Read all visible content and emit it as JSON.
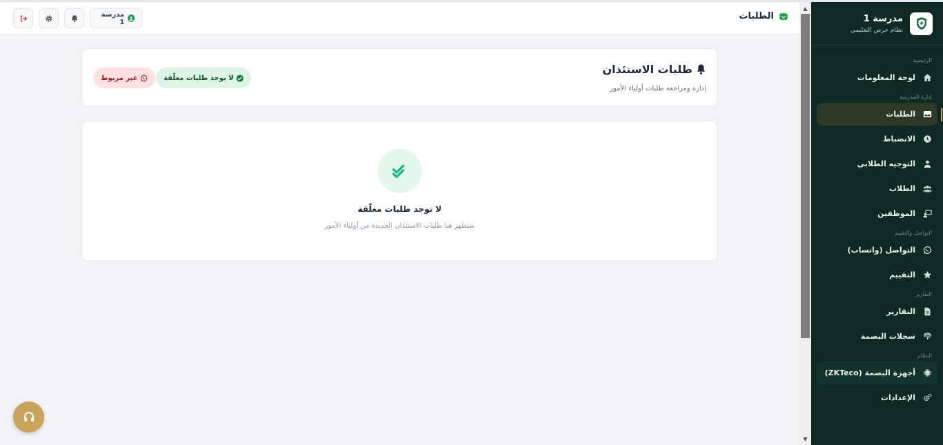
{
  "header": {
    "page_title": "الطلبات",
    "school_chip": "مدرسة 1"
  },
  "sidebar": {
    "brand_title": "مدرسة 1",
    "brand_subtitle": "نظام حرص التعليمي",
    "sections": {
      "main": "الرئيسية",
      "school": "إدارة المدرسة",
      "comm": "التواصل والتقييم",
      "reports": "التقارير",
      "system": "النظام"
    },
    "items": {
      "dashboard": "لوحة المعلومات",
      "requests": "الطلبات",
      "attendance": "الانضباط",
      "guidance": "التوجيه الطلابي",
      "students": "الطلاب",
      "staff": "الموظفين",
      "whatsapp": "التواصل (واتساب)",
      "rating": "التقييم",
      "reports": "التقارير",
      "fingerprint_logs": "سجلات البصمة",
      "devices": "أجهزة البصمة (ZKTeco)",
      "settings": "الإعدادات"
    }
  },
  "main": {
    "card_title": "طلبات الاستئذان",
    "card_subtitle": "إدارة ومراجعة طلبات أولياء الأمور",
    "pill_pending": "لا يوجد طلبات معلّقة",
    "pill_whatsapp": "غير مربوط",
    "empty_title": "لا توجد طلبات معلّقة",
    "empty_subtitle": "ستظهر هنا طلبات الاستئذان الجديدة من أولياء الأمور"
  },
  "colors": {
    "sidebar_bg": "#0f2a24",
    "accent_gold": "#c9a45a",
    "success_green": "#16a34a",
    "danger_red": "#991b1b"
  },
  "icons": {
    "brand": "shield-logo-icon",
    "page": "inbox-icon",
    "notifications": "bell-icon",
    "settings": "gear-icon",
    "logout": "logout-icon",
    "support": "headset-icon"
  }
}
